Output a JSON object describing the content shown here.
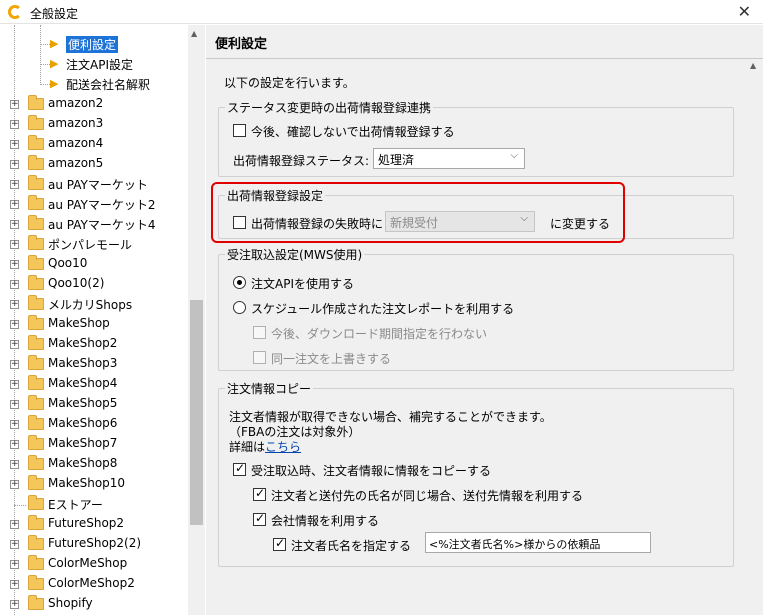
{
  "window": {
    "title": "全般設定",
    "close_label": "✕"
  },
  "tree": {
    "children": [
      {
        "label": "便利設定",
        "selected": true
      },
      {
        "label": "注文API設定",
        "selected": false
      },
      {
        "label": "配送会社名解釈",
        "selected": false
      }
    ],
    "folders": [
      {
        "label": "amazon2",
        "expandable": true
      },
      {
        "label": "amazon3",
        "expandable": true
      },
      {
        "label": "amazon4",
        "expandable": true
      },
      {
        "label": "amazon5",
        "expandable": true
      },
      {
        "label": "au PAYマーケット",
        "expandable": true
      },
      {
        "label": "au PAYマーケット2",
        "expandable": true
      },
      {
        "label": "au PAYマーケット4",
        "expandable": true
      },
      {
        "label": "ポンパレモール",
        "expandable": true
      },
      {
        "label": "Qoo10",
        "expandable": true
      },
      {
        "label": "Qoo10(2)",
        "expandable": true
      },
      {
        "label": "メルカリShops",
        "expandable": true
      },
      {
        "label": "MakeShop",
        "expandable": true
      },
      {
        "label": "MakeShop2",
        "expandable": true
      },
      {
        "label": "MakeShop3",
        "expandable": true
      },
      {
        "label": "MakeShop4",
        "expandable": true
      },
      {
        "label": "MakeShop5",
        "expandable": true
      },
      {
        "label": "MakeShop6",
        "expandable": true
      },
      {
        "label": "MakeShop7",
        "expandable": true
      },
      {
        "label": "MakeShop8",
        "expandable": true
      },
      {
        "label": "MakeShop10",
        "expandable": true
      },
      {
        "label": "Eストアー",
        "expandable": false
      },
      {
        "label": "FutureShop2",
        "expandable": true
      },
      {
        "label": "FutureShop2(2)",
        "expandable": true
      },
      {
        "label": "ColorMeShop",
        "expandable": true
      },
      {
        "label": "ColorMeShop2",
        "expandable": true
      },
      {
        "label": "Shopify",
        "expandable": true
      }
    ]
  },
  "panel": {
    "title": "便利設定",
    "intro": "以下の設定を行います。",
    "status_group": {
      "title": "ステータス変更時の出荷情報登録連携",
      "checkbox_label": "今後、確認しないで出荷情報登録する",
      "checkbox_checked": false,
      "status_label": "出荷情報登録ステータス:",
      "status_value": "処理済"
    },
    "shipping_group": {
      "title": "出荷情報登録設定",
      "checkbox_label": "出荷情報登録の失敗時に",
      "checkbox_checked": false,
      "select_value": "新規受付",
      "suffix": "に変更する"
    },
    "order_group": {
      "title": "受注取込設定(MWS使用)",
      "radio1_label": "注文APIを使用する",
      "radio1_checked": true,
      "radio2_label": "スケジュール作成された注文レポートを利用する",
      "radio2_checked": false,
      "sub1_label": "今後、ダウンロード期間指定を行わない",
      "sub2_label": "同一注文を上書きする"
    },
    "copy_group": {
      "title": "注文情報コピー",
      "desc1": "注文者情報が取得できない場合、補完することができます。",
      "desc2": "（FBAの注文は対象外）",
      "detail_prefix": "詳細は",
      "detail_link": "こちら",
      "chk1_label": "受注取込時、注文者情報に情報をコピーする",
      "chk1_checked": true,
      "chk2_label": "注文者と送付先の氏名が同じ場合、送付先情報を利用する",
      "chk2_checked": true,
      "chk3_label": "会社情報を利用する",
      "chk3_checked": true,
      "chk4_label": "注文者氏名を指定する",
      "chk4_checked": true,
      "name_template": "<%注文者氏名%>様からの依頼品"
    }
  }
}
